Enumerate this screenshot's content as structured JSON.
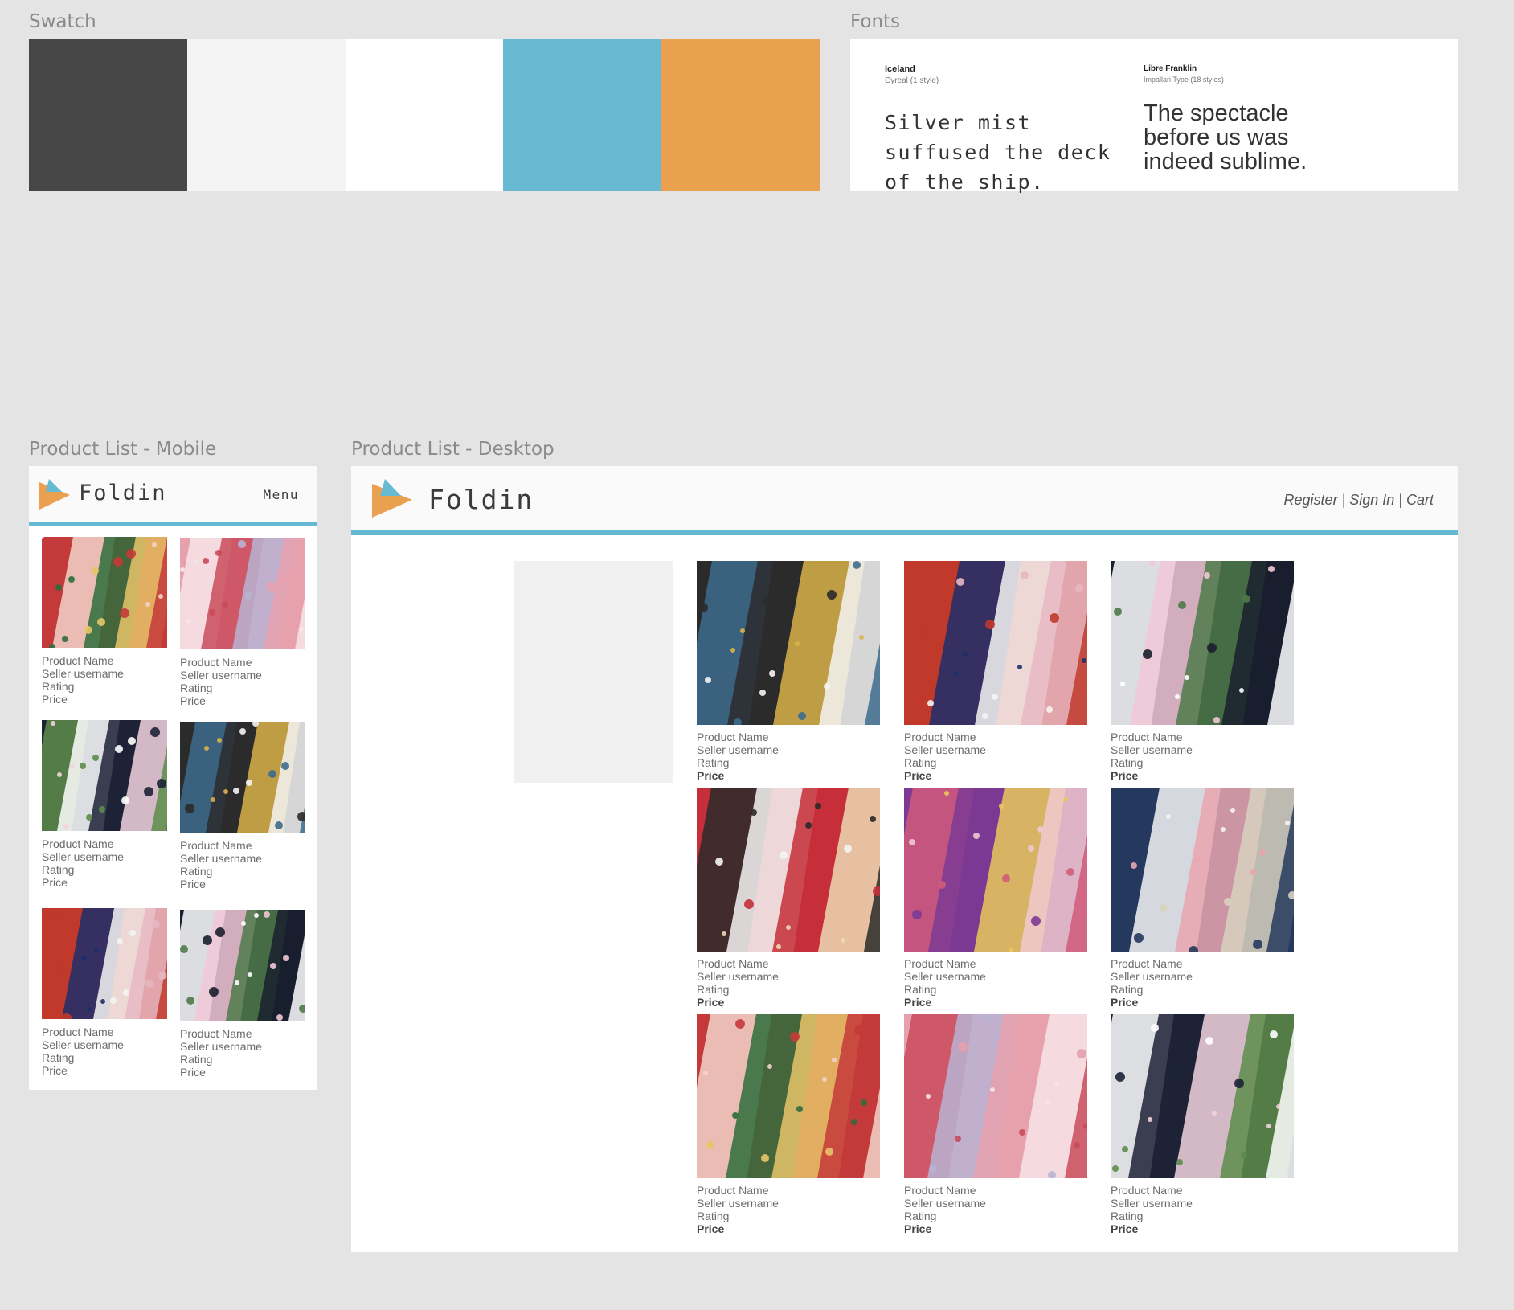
{
  "swatch": {
    "label": "Swatch",
    "colors": [
      "#474747",
      "#f4f4f4",
      "#ffffff",
      "#68b9d2",
      "#e9a150"
    ]
  },
  "fonts": {
    "label": "Fonts",
    "font1": {
      "name": "Iceland",
      "meta": "Cyreal (1 style)",
      "sample": "Silver mist suffused the deck of the ship."
    },
    "font2": {
      "name": "Libre Franklin",
      "meta": "Impallari Type (18 styles)",
      "sample": "The spectacle before us was indeed sublime."
    }
  },
  "mobile": {
    "label": "Product List - Mobile",
    "brand": "Foldin",
    "menu": "Menu",
    "products": [
      {
        "name": "Product Name",
        "seller": "Seller username",
        "rating": "Rating",
        "price": "Price"
      },
      {
        "name": "Product Name",
        "seller": "Seller username",
        "rating": "Rating",
        "price": "Price"
      },
      {
        "name": "Product Name",
        "seller": "Seller username",
        "rating": "Rating",
        "price": "Price"
      },
      {
        "name": "Product Name",
        "seller": "Seller username",
        "rating": "Rating",
        "price": "Price"
      },
      {
        "name": "Product Name",
        "seller": "Seller username",
        "rating": "Rating",
        "price": "Price"
      },
      {
        "name": "Product Name",
        "seller": "Seller username",
        "rating": "Rating",
        "price": "Price"
      }
    ]
  },
  "desktop": {
    "label": "Product List - Desktop",
    "brand": "Foldin",
    "nav": {
      "register": "Register",
      "signin": "Sign In",
      "cart": "Cart",
      "sep": " | "
    },
    "products": [
      {
        "name": "Product Name",
        "seller": "Seller username",
        "rating": "Rating",
        "price": "Price"
      },
      {
        "name": "Product Name",
        "seller": "Seller username",
        "rating": "Rating",
        "price": "Price"
      },
      {
        "name": "Product Name",
        "seller": "Seller username",
        "rating": "Rating",
        "price": "Price"
      },
      {
        "name": "Product Name",
        "seller": "Seller username",
        "rating": "Rating",
        "price": "Price"
      },
      {
        "name": "Product Name",
        "seller": "Seller username",
        "rating": "Rating",
        "price": "Price"
      },
      {
        "name": "Product Name",
        "seller": "Seller username",
        "rating": "Rating",
        "price": "Price"
      },
      {
        "name": "Product Name",
        "seller": "Seller username",
        "rating": "Rating",
        "price": "Price"
      },
      {
        "name": "Product Name",
        "seller": "Seller username",
        "rating": "Rating",
        "price": "Price"
      },
      {
        "name": "Product Name",
        "seller": "Seller username",
        "rating": "Rating",
        "price": "Price"
      }
    ]
  }
}
